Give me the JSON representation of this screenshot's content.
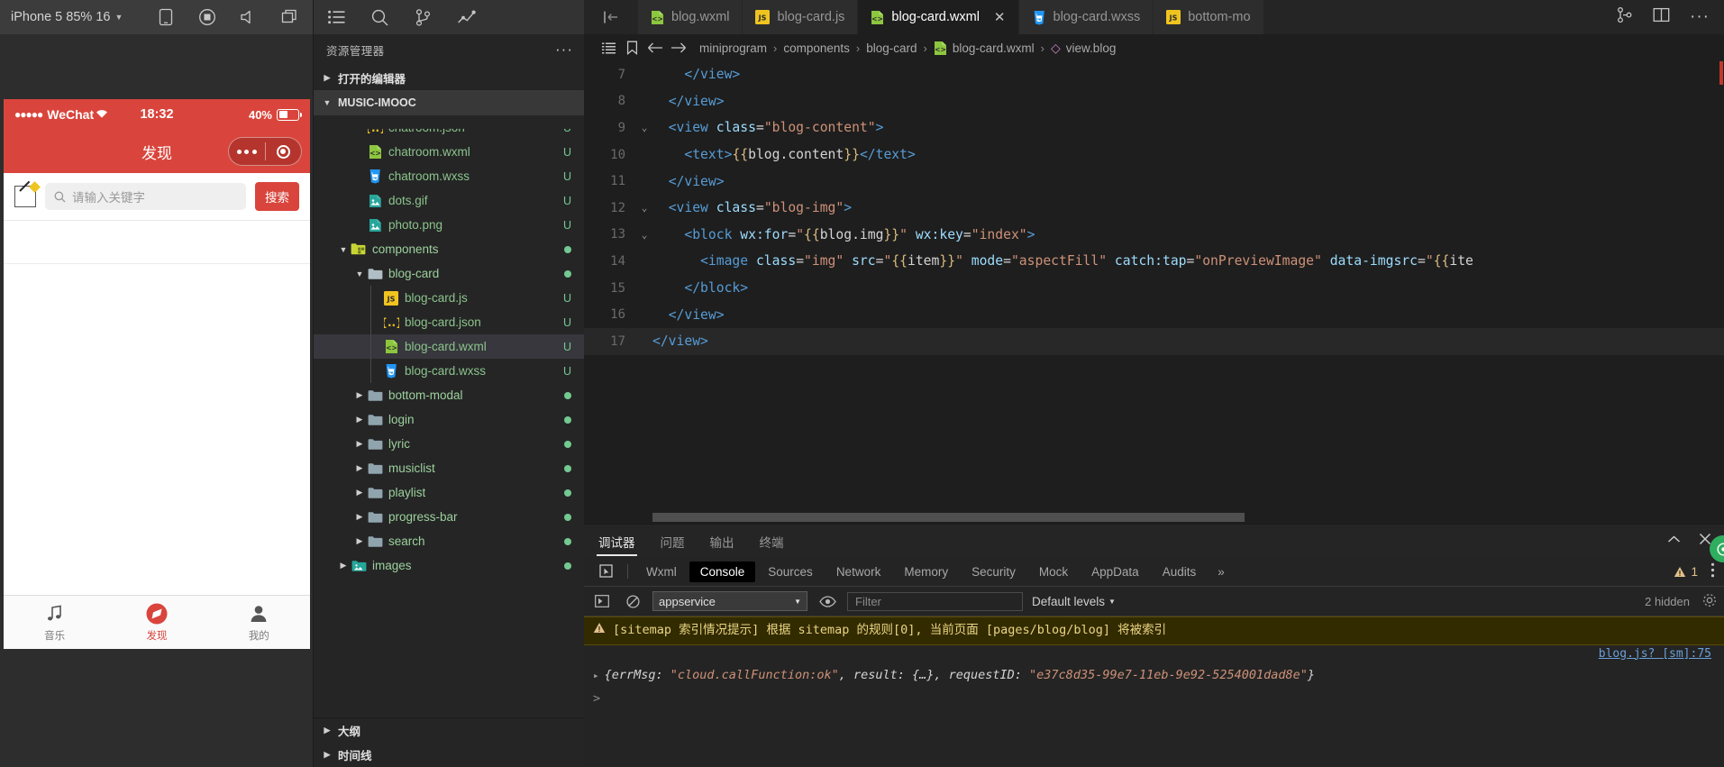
{
  "simulator": {
    "device_label": "iPhone 5 85% 16",
    "toolbar_icons": [
      "phone-icon",
      "record-icon",
      "volume-icon",
      "windows-icon"
    ],
    "phone": {
      "status": {
        "carrier": "WeChat",
        "dots": "●●●●●",
        "time": "18:32",
        "battery": "40%"
      },
      "nav_title": "发现",
      "search_placeholder": "请输入关键字",
      "search_button": "搜索",
      "tabbar": [
        {
          "label": "音乐",
          "icon": "music-note-icon",
          "active": false
        },
        {
          "label": "发现",
          "icon": "compass-icon",
          "active": true
        },
        {
          "label": "我的",
          "icon": "person-icon",
          "active": false
        }
      ]
    }
  },
  "explorer": {
    "activity_icons": [
      "list-icon",
      "search-icon",
      "source-control-icon",
      "debug-icon"
    ],
    "title": "资源管理器",
    "more_label": "···",
    "open_editors": "打开的编辑器",
    "project": "MUSIC-IMOOC",
    "tree": [
      {
        "name": "chatroom.json",
        "type": "json",
        "depth": 3,
        "status": "U",
        "clipped": true
      },
      {
        "name": "chatroom.wxml",
        "type": "wxml",
        "depth": 3,
        "status": "U"
      },
      {
        "name": "chatroom.wxss",
        "type": "wxss",
        "depth": 3,
        "status": "U"
      },
      {
        "name": "dots.gif",
        "type": "img",
        "depth": 3,
        "status": "U"
      },
      {
        "name": "photo.png",
        "type": "img",
        "depth": 3,
        "status": "U"
      },
      {
        "name": "components",
        "type": "folder-open-special",
        "depth": 2,
        "dot": true,
        "expanded": true
      },
      {
        "name": "blog-card",
        "type": "folder-open",
        "depth": 3,
        "dot": true,
        "expanded": true
      },
      {
        "name": "blog-card.js",
        "type": "js",
        "depth": 4,
        "status": "U"
      },
      {
        "name": "blog-card.json",
        "type": "json",
        "depth": 4,
        "status": "U"
      },
      {
        "name": "blog-card.wxml",
        "type": "wxml",
        "depth": 4,
        "status": "U",
        "selected": true
      },
      {
        "name": "blog-card.wxss",
        "type": "wxss",
        "depth": 4,
        "status": "U"
      },
      {
        "name": "bottom-modal",
        "type": "folder",
        "depth": 3,
        "dot": true,
        "expanded": false
      },
      {
        "name": "login",
        "type": "folder",
        "depth": 3,
        "dot": true,
        "expanded": false
      },
      {
        "name": "lyric",
        "type": "folder",
        "depth": 3,
        "dot": true,
        "expanded": false
      },
      {
        "name": "musiclist",
        "type": "folder",
        "depth": 3,
        "dot": true,
        "expanded": false
      },
      {
        "name": "playlist",
        "type": "folder",
        "depth": 3,
        "dot": true,
        "expanded": false
      },
      {
        "name": "progress-bar",
        "type": "folder",
        "depth": 3,
        "dot": true,
        "expanded": false
      },
      {
        "name": "search",
        "type": "folder",
        "depth": 3,
        "dot": true,
        "expanded": false
      },
      {
        "name": "images",
        "type": "folder-img",
        "depth": 2,
        "dot": true,
        "expanded": false
      }
    ],
    "outline": "大纲",
    "timeline": "时间线"
  },
  "editor": {
    "tabs": [
      {
        "label": "blog.wxml",
        "icon": "wxml",
        "active": false,
        "closable": false
      },
      {
        "label": "blog-card.js",
        "icon": "js",
        "active": false,
        "closable": false
      },
      {
        "label": "blog-card.wxml",
        "icon": "wxml",
        "active": true,
        "closable": true
      },
      {
        "label": "blog-card.wxss",
        "icon": "wxss",
        "active": false,
        "closable": false
      },
      {
        "label": "bottom-mo",
        "icon": "js",
        "active": false,
        "closable": false
      }
    ],
    "tab_actions": [
      "split-vertical-icon",
      "split-editor-icon",
      "more-actions-icon"
    ],
    "breadcrumb": {
      "icons": [
        "outline-icon",
        "bookmark-icon",
        "back-arrow-icon",
        "forward-arrow-icon"
      ],
      "segments": [
        "miniprogram",
        "components",
        "blog-card",
        "blog-card.wxml",
        "view.blog"
      ],
      "separator": "›"
    },
    "lines": [
      {
        "n": 7,
        "fold": "",
        "indent": 1,
        "tokens": [
          {
            "t": "    ",
            "c": "plain"
          },
          {
            "t": "</view>",
            "c": "tag"
          }
        ]
      },
      {
        "n": 8,
        "fold": "",
        "indent": 0,
        "tokens": [
          {
            "t": "  ",
            "c": "plain"
          },
          {
            "t": "</view>",
            "c": "tag"
          }
        ]
      },
      {
        "n": 9,
        "fold": "v",
        "indent": 0,
        "tokens": [
          {
            "t": "  ",
            "c": "plain"
          },
          {
            "t": "<view ",
            "c": "tag"
          },
          {
            "t": "class",
            "c": "attr"
          },
          {
            "t": "=",
            "c": "op"
          },
          {
            "t": "\"blog-content\"",
            "c": "str"
          },
          {
            "t": ">",
            "c": "tag"
          }
        ]
      },
      {
        "n": 10,
        "fold": "",
        "indent": 1,
        "tokens": [
          {
            "t": "    ",
            "c": "plain"
          },
          {
            "t": "<text>",
            "c": "tag"
          },
          {
            "t": "{{",
            "c": "mus"
          },
          {
            "t": "blog.content",
            "c": "plain"
          },
          {
            "t": "}}",
            "c": "mus"
          },
          {
            "t": "</text>",
            "c": "tag"
          }
        ]
      },
      {
        "n": 11,
        "fold": "",
        "indent": 0,
        "tokens": [
          {
            "t": "  ",
            "c": "plain"
          },
          {
            "t": "</view>",
            "c": "tag"
          }
        ]
      },
      {
        "n": 12,
        "fold": "v",
        "indent": 0,
        "tokens": [
          {
            "t": "  ",
            "c": "plain"
          },
          {
            "t": "<view ",
            "c": "tag"
          },
          {
            "t": "class",
            "c": "attr"
          },
          {
            "t": "=",
            "c": "op"
          },
          {
            "t": "\"blog-img\"",
            "c": "str"
          },
          {
            "t": ">",
            "c": "tag"
          }
        ]
      },
      {
        "n": 13,
        "fold": "v",
        "indent": 1,
        "tokens": [
          {
            "t": "    ",
            "c": "plain"
          },
          {
            "t": "<block ",
            "c": "tag"
          },
          {
            "t": "wx:for",
            "c": "attr"
          },
          {
            "t": "=",
            "c": "op"
          },
          {
            "t": "\"",
            "c": "str"
          },
          {
            "t": "{{",
            "c": "mus"
          },
          {
            "t": "blog.img",
            "c": "plain"
          },
          {
            "t": "}}",
            "c": "mus"
          },
          {
            "t": "\"",
            "c": "str"
          },
          {
            "t": " wx:key",
            "c": "attr"
          },
          {
            "t": "=",
            "c": "op"
          },
          {
            "t": "\"index\"",
            "c": "str"
          },
          {
            "t": ">",
            "c": "tag"
          }
        ]
      },
      {
        "n": 14,
        "fold": "",
        "indent": 2,
        "tokens": [
          {
            "t": "      ",
            "c": "plain"
          },
          {
            "t": "<image ",
            "c": "tag"
          },
          {
            "t": "class",
            "c": "attr"
          },
          {
            "t": "=",
            "c": "op"
          },
          {
            "t": "\"img\"",
            "c": "str"
          },
          {
            "t": " src",
            "c": "attr"
          },
          {
            "t": "=",
            "c": "op"
          },
          {
            "t": "\"",
            "c": "str"
          },
          {
            "t": "{{",
            "c": "mus"
          },
          {
            "t": "item",
            "c": "plain"
          },
          {
            "t": "}}",
            "c": "mus"
          },
          {
            "t": "\"",
            "c": "str"
          },
          {
            "t": " mode",
            "c": "attr"
          },
          {
            "t": "=",
            "c": "op"
          },
          {
            "t": "\"aspectFill\"",
            "c": "str"
          },
          {
            "t": " catch:tap",
            "c": "attr"
          },
          {
            "t": "=",
            "c": "op"
          },
          {
            "t": "\"onPreviewImage\"",
            "c": "str"
          },
          {
            "t": " data-imgsrc",
            "c": "attr"
          },
          {
            "t": "=",
            "c": "op"
          },
          {
            "t": "\"",
            "c": "str"
          },
          {
            "t": "{{",
            "c": "mus"
          },
          {
            "t": "ite",
            "c": "plain"
          }
        ]
      },
      {
        "n": 15,
        "fold": "",
        "indent": 1,
        "tokens": [
          {
            "t": "    ",
            "c": "plain"
          },
          {
            "t": "</block>",
            "c": "tag"
          }
        ]
      },
      {
        "n": 16,
        "fold": "",
        "indent": 0,
        "tokens": [
          {
            "t": "  ",
            "c": "plain"
          },
          {
            "t": "</view>",
            "c": "tag"
          }
        ]
      },
      {
        "n": 17,
        "fold": "",
        "indent": 0,
        "cursor": true,
        "tokens": [
          {
            "t": "</view>",
            "c": "tag"
          }
        ]
      }
    ]
  },
  "devtools": {
    "panel_tabs": [
      {
        "label": "调试器",
        "active": true
      },
      {
        "label": "问题",
        "active": false
      },
      {
        "label": "输出",
        "active": false
      },
      {
        "label": "终端",
        "active": false
      }
    ],
    "panel_actions": [
      "chevron-up-icon",
      "close-icon"
    ],
    "inspect_icon": "inspect-element-icon",
    "dev_tabs": [
      {
        "label": "Wxml",
        "active": false
      },
      {
        "label": "Console",
        "active": true
      },
      {
        "label": "Sources",
        "active": false
      },
      {
        "label": "Network",
        "active": false
      },
      {
        "label": "Memory",
        "active": false
      },
      {
        "label": "Security",
        "active": false
      },
      {
        "label": "Mock",
        "active": false
      },
      {
        "label": "AppData",
        "active": false
      },
      {
        "label": "Audits",
        "active": false
      }
    ],
    "overflow": "»",
    "warning_count": "1",
    "more_icon": "kebab-menu-icon",
    "toolbar": {
      "execute_icon": "execute-context-icon",
      "clear_icon": "clear-console-icon",
      "context": "appservice",
      "eye_icon": "eye-icon",
      "filter_placeholder": "Filter",
      "levels": "Default levels",
      "hidden": "2 hidden",
      "settings_icon": "settings-gear-icon"
    },
    "messages": [
      {
        "kind": "warning",
        "icon": "warning-triangle-icon",
        "text": "[sitemap 索引情况提示] 根据 sitemap 的规则[0], 当前页面 [pages/blog/blog] 将被索引"
      },
      {
        "kind": "source",
        "text": "blog.js? [sm]:75"
      },
      {
        "kind": "object",
        "arrow": "▸",
        "parts": [
          {
            "t": "{errMsg: ",
            "c": "plain"
          },
          {
            "t": "\"cloud.callFunction:ok\"",
            "c": "str"
          },
          {
            "t": ", result: {…}, requestID: ",
            "c": "plain"
          },
          {
            "t": "\"e37c8d35-99e7-11eb-9e92-5254001dad8e\"",
            "c": "str"
          },
          {
            "t": "}",
            "c": "plain"
          }
        ]
      }
    ],
    "prompt": ">",
    "fab_icon": "help-fab-icon"
  }
}
